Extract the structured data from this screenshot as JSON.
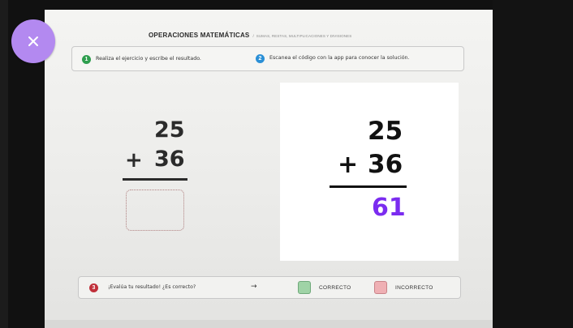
{
  "header": {
    "title": "OPERACIONES MATEMÁTICAS",
    "separator": "/",
    "subtitle": "SUMAS, RESTAS, MULTIPLICACIONES Y DIVISIONES"
  },
  "close_button": {
    "icon": "close-icon"
  },
  "instructions": {
    "step1": {
      "number": "1",
      "text": "Realiza el ejercicio y escribe el resultado.",
      "color": "#2e9e4e"
    },
    "step2": {
      "number": "2",
      "text": "Escanea el código con la app para conocer la solución.",
      "color": "#2a8fd6"
    }
  },
  "exercise": {
    "operand_top": "25",
    "operator": "+",
    "operand_bottom": "36"
  },
  "solution": {
    "operand_top": "25",
    "operator": "+",
    "operand_bottom": "36",
    "result": "61",
    "result_color": "#7b2cf0"
  },
  "evaluation": {
    "number": "3",
    "number_color": "#c0303a",
    "prompt": "¡Evalúa tu resultado! ¿Es correcto?",
    "arrow": "→",
    "correct_label": "CORRECTO",
    "correct_color": "#9fd3a6",
    "incorrect_label": "INCORRECTO",
    "incorrect_color": "#efb0b4"
  },
  "colors": {
    "accent": "#b389f0"
  }
}
